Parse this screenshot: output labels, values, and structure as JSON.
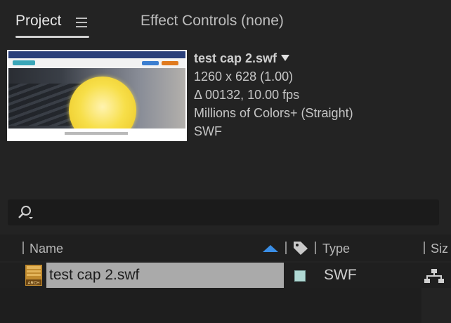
{
  "tabs": {
    "project": "Project",
    "effect_controls": "Effect Controls (none)"
  },
  "preview": {
    "filename": "test cap 2.swf",
    "dimensions": "1260 x 628 (1.00)",
    "duration": "Δ 00132, 10.00 fps",
    "color": "Millions of Colors+ (Straight)",
    "format": "SWF"
  },
  "search": {
    "value": "",
    "placeholder": ""
  },
  "columns": {
    "name": "Name",
    "type": "Type",
    "size": "Siz"
  },
  "items": [
    {
      "name": "test cap 2.swf",
      "type": "SWF",
      "label_color": "#b0d9d4",
      "icon": "archive-icon"
    }
  ],
  "colors": {
    "accent": "#3a8ee6",
    "selection": "#aaaaaa",
    "panel_bg": "#232323"
  }
}
